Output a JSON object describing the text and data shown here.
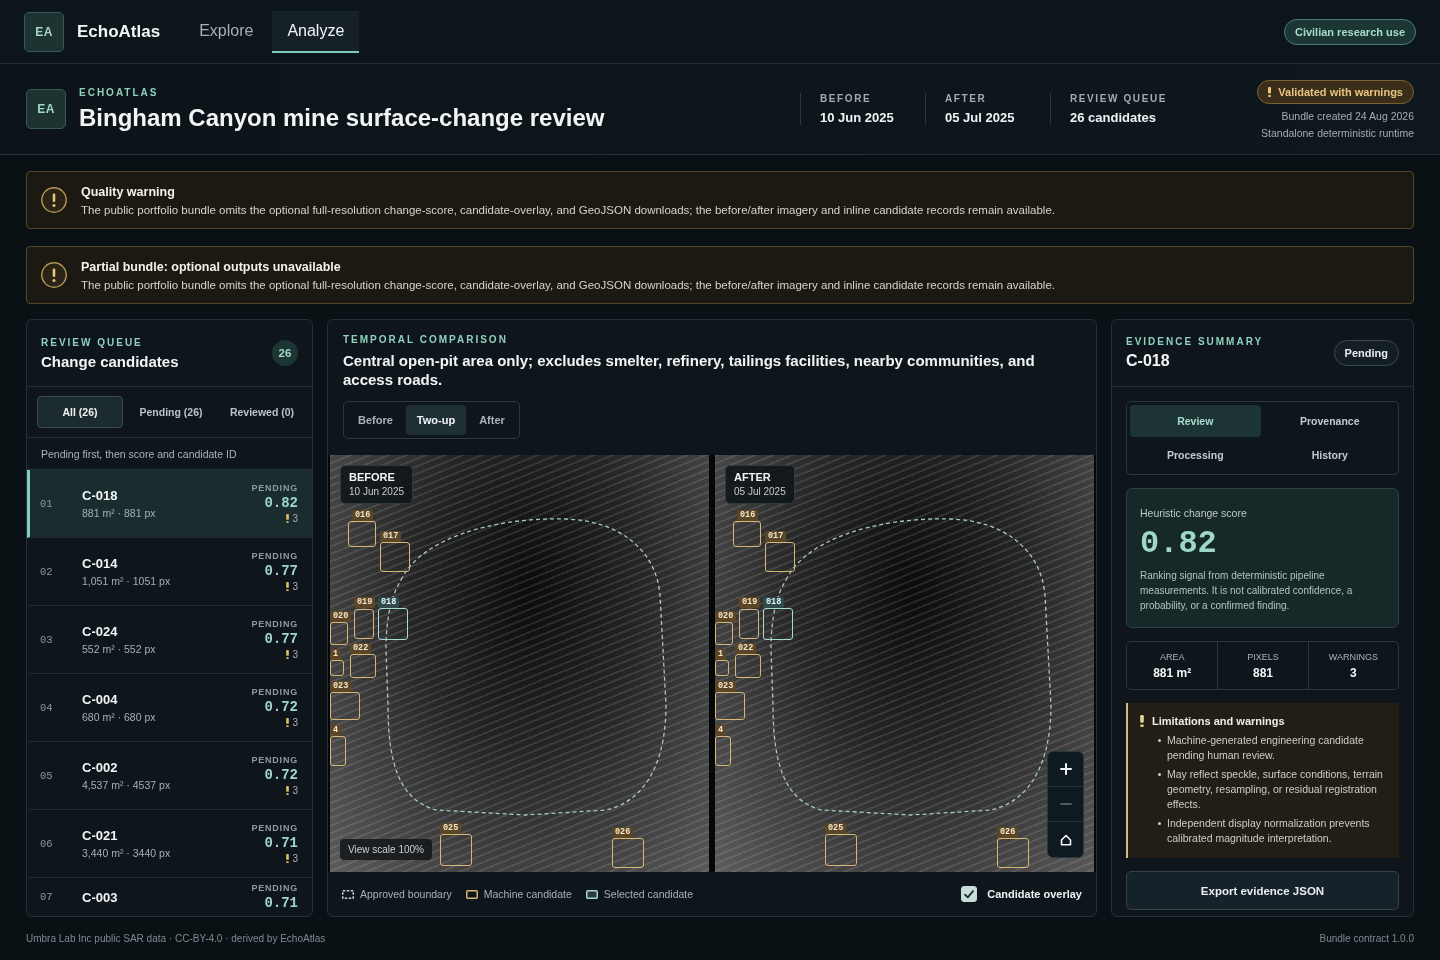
{
  "nav": {
    "logo": "EA",
    "brand": "EchoAtlas",
    "tabs": [
      {
        "label": "Explore",
        "selected": false
      },
      {
        "label": "Analyze",
        "selected": true
      }
    ],
    "badge": "Civilian research use"
  },
  "header": {
    "logo": "EA",
    "eyebrow": "ECHOATLAS",
    "title": "Bingham Canyon mine surface-change review",
    "meta": [
      {
        "label": "BEFORE",
        "value": "10 Jun 2025"
      },
      {
        "label": "AFTER",
        "value": "05 Jul 2025"
      },
      {
        "label": "REVIEW QUEUE",
        "value": "26 candidates"
      }
    ],
    "status": "Validated with warnings",
    "bundle_created": "Bundle created 24 Aug 2026",
    "runtime": "Standalone deterministic runtime"
  },
  "alerts": [
    {
      "title": "Quality warning",
      "text": "The public portfolio bundle omits the optional full-resolution change-score, candidate-overlay, and GeoJSON downloads; the before/after imagery and inline candidate records remain available."
    },
    {
      "title": "Partial bundle: optional outputs unavailable",
      "text": "The public portfolio bundle omits the optional full-resolution change-score, candidate-overlay, and GeoJSON downloads; the before/after imagery and inline candidate records remain available."
    }
  ],
  "queue": {
    "eyebrow": "REVIEW QUEUE",
    "title": "Change candidates",
    "count": "26",
    "filters": [
      {
        "label": "All (26)",
        "selected": true
      },
      {
        "label": "Pending (26)",
        "selected": false
      },
      {
        "label": "Reviewed (0)",
        "selected": false
      }
    ],
    "sort_note": "Pending first, then score and candidate ID",
    "rows": [
      {
        "index": "01",
        "id": "C-018",
        "size": "881 m² · 881 px",
        "status": "PENDING",
        "score": "0.82",
        "warnings": "3",
        "selected": true
      },
      {
        "index": "02",
        "id": "C-014",
        "size": "1,051 m² · 1051 px",
        "status": "PENDING",
        "score": "0.77",
        "warnings": "3",
        "selected": false
      },
      {
        "index": "03",
        "id": "C-024",
        "size": "552 m² · 552 px",
        "status": "PENDING",
        "score": "0.77",
        "warnings": "3",
        "selected": false
      },
      {
        "index": "04",
        "id": "C-004",
        "size": "680 m² · 680 px",
        "status": "PENDING",
        "score": "0.72",
        "warnings": "3",
        "selected": false
      },
      {
        "index": "05",
        "id": "C-002",
        "size": "4,537 m² · 4537 px",
        "status": "PENDING",
        "score": "0.72",
        "warnings": "3",
        "selected": false
      },
      {
        "index": "06",
        "id": "C-021",
        "size": "3,440 m² · 3440 px",
        "status": "PENDING",
        "score": "0.71",
        "warnings": "3",
        "selected": false
      },
      {
        "index": "07",
        "id": "C-003",
        "status": "PENDING",
        "score": "0.71",
        "selected": false
      }
    ]
  },
  "comparison": {
    "eyebrow": "TEMPORAL COMPARISON",
    "caption": "Central open-pit area only; excludes smelter, refinery, tailings facilities, nearby communities, and access roads.",
    "modes": [
      {
        "label": "Before",
        "selected": false
      },
      {
        "label": "Two-up",
        "selected": true
      },
      {
        "label": "After",
        "selected": false
      }
    ],
    "panes": [
      {
        "title": "BEFORE",
        "date": "10 Jun 2025",
        "view_scale": "View scale 100%",
        "markers": [
          {
            "label": "016",
            "selected": false
          },
          {
            "label": "017",
            "selected": false
          },
          {
            "label": "018",
            "selected": true
          },
          {
            "label": "019",
            "selected": false
          },
          {
            "label": "020",
            "selected": false
          },
          {
            "label": "1",
            "selected": false
          },
          {
            "label": "022",
            "selected": false
          },
          {
            "label": "023",
            "selected": false
          },
          {
            "label": "4",
            "selected": false
          },
          {
            "label": "025",
            "selected": false
          },
          {
            "label": "026",
            "selected": false
          }
        ]
      },
      {
        "title": "AFTER",
        "date": "05 Jul 2025",
        "markers": [
          {
            "label": "016",
            "selected": false
          },
          {
            "label": "017",
            "selected": false
          },
          {
            "label": "018",
            "selected": true
          },
          {
            "label": "019",
            "selected": false
          },
          {
            "label": "020",
            "selected": false
          },
          {
            "label": "1",
            "selected": false
          },
          {
            "label": "022",
            "selected": false
          },
          {
            "label": "023",
            "selected": false
          },
          {
            "label": "4",
            "selected": false
          },
          {
            "label": "025",
            "selected": false
          },
          {
            "label": "026",
            "selected": false
          }
        ]
      }
    ],
    "zoom_controls": [
      {
        "kind": "zoom-in",
        "disabled": false
      },
      {
        "kind": "zoom-out",
        "disabled": true
      },
      {
        "kind": "reset",
        "disabled": false
      }
    ],
    "legend": [
      {
        "kind": "boundary",
        "label": "Approved boundary"
      },
      {
        "kind": "candidate",
        "label": "Machine candidate"
      },
      {
        "kind": "selected",
        "label": "Selected candidate"
      }
    ],
    "overlay_toggle": {
      "label": "Candidate overlay",
      "checked": true
    }
  },
  "evidence": {
    "eyebrow": "EVIDENCE SUMMARY",
    "title": "C-018",
    "status": "Pending",
    "tabs": [
      {
        "label": "Review",
        "selected": true
      },
      {
        "label": "Provenance",
        "selected": false
      },
      {
        "label": "Processing",
        "selected": false
      },
      {
        "label": "History",
        "selected": false
      }
    ],
    "score_label": "Heuristic change score",
    "score": "0.82",
    "score_note": "Ranking signal from deterministic pipeline measurements. It is not calibrated confidence, a probability, or a confirmed finding.",
    "stats": [
      {
        "label": "AREA",
        "value": "881 m²"
      },
      {
        "label": "PIXELS",
        "value": "881"
      },
      {
        "label": "WARNINGS",
        "value": "3"
      }
    ],
    "limitations": {
      "title": "Limitations and warnings",
      "items": [
        "Machine-generated engineering candidate pending human review.",
        "May reflect speckle, surface conditions, terrain geometry, resampling, or residual registration effects.",
        "Independent display normalization prevents calibrated magnitude interpretation."
      ]
    },
    "export": "Export evidence JSON"
  },
  "footer": {
    "attribution": "Umbra Lab Inc public SAR data · CC-BY-4.0 · derived by EchoAtlas",
    "contract": "Bundle contract 1.0.0"
  }
}
